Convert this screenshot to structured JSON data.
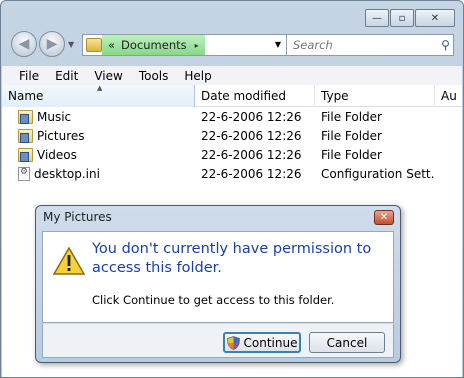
{
  "window": {
    "caption_buttons": {
      "minimize": "—",
      "maximize": "▫",
      "close": "✕"
    }
  },
  "nav": {
    "back_icon": "back-arrow-icon",
    "forward_icon": "forward-arrow-icon",
    "address": {
      "chevrons": "«",
      "crumb": "Documents",
      "crumb_arrow": "▸"
    },
    "search_placeholder": "Search"
  },
  "menu": [
    "File",
    "Edit",
    "View",
    "Tools",
    "Help"
  ],
  "columns": [
    "Name",
    "Date modified",
    "Type",
    "Au"
  ],
  "rows": [
    {
      "name": "Music",
      "date": "22-6-2006 12:26",
      "type": "File Folder",
      "icon": "folder"
    },
    {
      "name": "Pictures",
      "date": "22-6-2006 12:26",
      "type": "File Folder",
      "icon": "folder"
    },
    {
      "name": "Videos",
      "date": "22-6-2006 12:26",
      "type": "File Folder",
      "icon": "folder"
    },
    {
      "name": "desktop.ini",
      "date": "22-6-2006 12:26",
      "type": "Configuration Sett...",
      "icon": "settings-file"
    }
  ],
  "dialog": {
    "title": "My Pictures",
    "heading": "You don't currently have permission to access this folder.",
    "text": "Click Continue to get access to this folder.",
    "continue_label": "Continue",
    "cancel_label": "Cancel"
  },
  "colors": {
    "heading": "#1a3fa6",
    "breadcrumb": "#86d886",
    "close": "#c34e2e"
  }
}
